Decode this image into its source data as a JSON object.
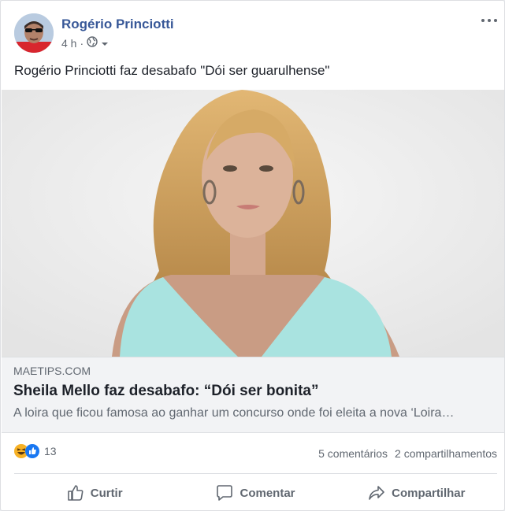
{
  "post": {
    "author": "Rogério Princiotti",
    "time": "4 h",
    "privacy_icon": "globe-icon",
    "text": "Rogério Princiotti faz desabafo \"Dói ser guarulhense\""
  },
  "link": {
    "domain": "MAETIPS.COM",
    "title": "Sheila Mello faz desabafo: “Dói ser bonita”",
    "description": "A loira que ficou famosa ao ganhar um concurso onde foi eleita a nova ‘Loira…"
  },
  "stats": {
    "reaction_icons": [
      "haha-icon",
      "like-icon"
    ],
    "reaction_count": "13",
    "comments": "5 comentários",
    "shares": "2 compartilhamentos"
  },
  "actions": {
    "like": "Curtir",
    "comment": "Comentar",
    "share": "Compartilhar"
  },
  "colors": {
    "author_link": "#385898",
    "muted_text": "#606770",
    "like_blue": "#1877f2",
    "haha_yellow": "#f7b125",
    "dress": "#a9e3e0"
  }
}
